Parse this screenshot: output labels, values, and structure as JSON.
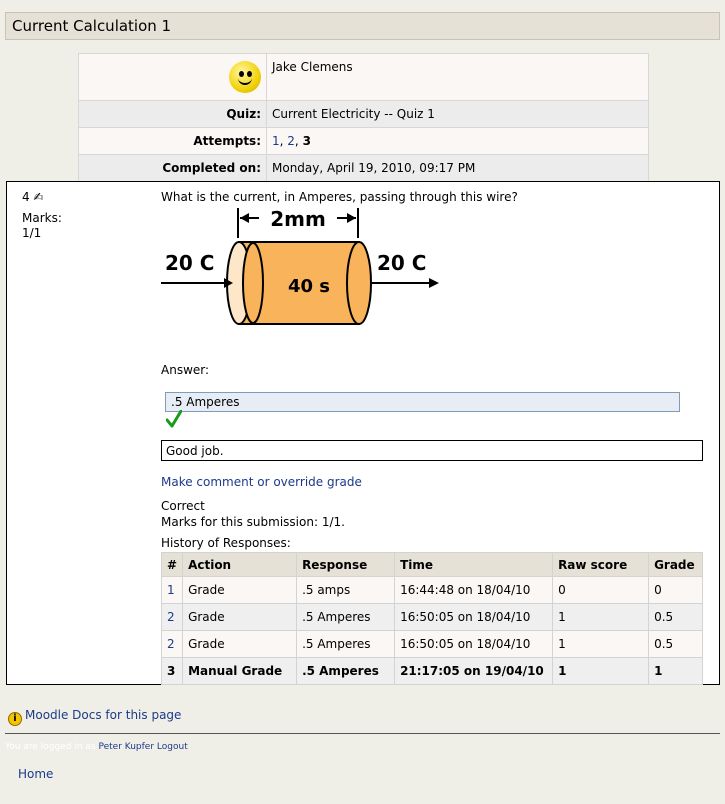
{
  "page": {
    "title": "Current Calculation 1"
  },
  "summary": {
    "user_name": "Jake Clemens",
    "rows": [
      {
        "label": "Quiz:",
        "value": "Current Electricity -- Quiz 1"
      },
      {
        "label": "Attempts:"
      },
      {
        "label": "Completed on:",
        "value": "Monday, April 19, 2010, 09:17 PM"
      }
    ],
    "attempts": {
      "links": [
        "1",
        "2"
      ],
      "current": "3",
      "sep": ", "
    }
  },
  "question": {
    "number": "4",
    "marks_label": "Marks:",
    "marks_value": "1/1",
    "text": "What is the current, in Amperes, passing through this wire?",
    "diagram": {
      "length": "2mm",
      "charge_in": "20 C",
      "time": "40 s",
      "charge_out": "20 C"
    },
    "answer_label": "Answer:",
    "answer_value": ".5 Amperes",
    "feedback": "Good job.",
    "comment_link": "Make comment or override grade",
    "status": "Correct",
    "marks_submission": "Marks for this submission: 1/1.",
    "history_label": "History of Responses:",
    "history": {
      "headers": [
        "#",
        "Action",
        "Response",
        "Time",
        "Raw score",
        "Grade"
      ],
      "rows": [
        [
          "1",
          "Grade",
          ".5 amps",
          "16:44:48 on 18/04/10",
          "0",
          "0"
        ],
        [
          "2",
          "Grade",
          ".5 Amperes",
          "16:50:05 on 18/04/10",
          "1",
          "0.5"
        ],
        [
          "2",
          "Grade",
          ".5 Amperes",
          "16:50:05 on 18/04/10",
          "1",
          "0.5"
        ],
        [
          "3",
          "Manual Grade",
          ".5 Amperes",
          "21:17:05 on 19/04/10",
          "1",
          "1"
        ]
      ]
    }
  },
  "footer": {
    "docs_link": "Moodle Docs for this page",
    "logged_in_prefix": "You are logged in as",
    "user_link": "Peter Kupfer",
    "logout_link": "Logout",
    "home_link": "Home"
  },
  "colors": {
    "link": "#1d3a8a",
    "header_bg": "#e5e1d6",
    "tick": "#1a9a1a"
  }
}
